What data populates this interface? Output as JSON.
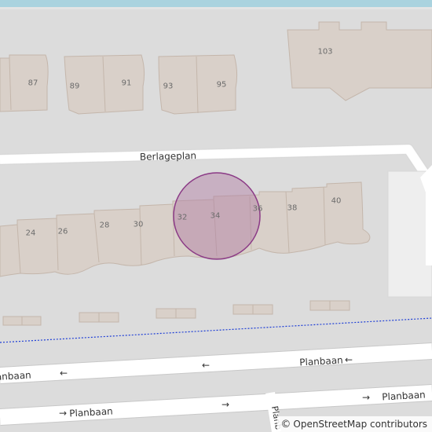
{
  "colors": {
    "background": "#dcdcdc",
    "water": "#aad3df",
    "road": "#ffffff",
    "building_fill": "#d9d0c9",
    "building_stroke": "#c4b6ab",
    "parking": "#eeeeee",
    "marker_fill": "#b07aa1",
    "marker_stroke": "#8b3a86",
    "boundary": "#1f3fd6"
  },
  "street_names": {
    "berlageplan": "Berlageplan",
    "planbaan_left": "Planbaan",
    "planbaan_mid": "Planbaan",
    "planbaan_bottom_left": "Planbaan",
    "planbaan_bottom_right": "Planbaan",
    "planbaan_vertical": "Planb"
  },
  "arrow_glyphs": {
    "left": "←",
    "right": "→"
  },
  "house_numbers": {
    "n87": "87",
    "n89": "89",
    "n91": "91",
    "n93": "93",
    "n95": "95",
    "n103": "103",
    "n24": "24",
    "n26": "26",
    "n28": "28",
    "n30": "30",
    "n32": "32",
    "n34": "34",
    "n36": "36",
    "n38": "38",
    "n40": "40"
  },
  "attribution": {
    "symbol": "©",
    "text": "OpenStreetMap contributors"
  }
}
